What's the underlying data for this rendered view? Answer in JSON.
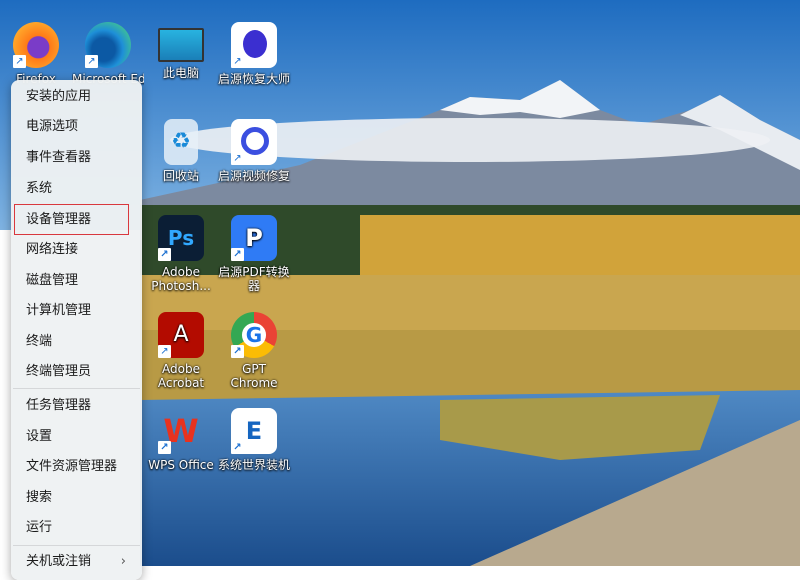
{
  "desktop_icons": [
    {
      "label": "Firefox",
      "color": "#ff7a18"
    },
    {
      "label": "Microsoft Edge",
      "color": "#1e8fd8"
    },
    {
      "label": "此电脑",
      "color": "#2aa6d8"
    },
    {
      "label": "启源恢复大师",
      "color": "#ffffff"
    },
    {
      "label": "回收站",
      "color": "#cfe4f2"
    },
    {
      "label": "启源视频修复",
      "color": "#ffffff"
    },
    {
      "label": "Adobe Photosh...",
      "color": "#0b1e35",
      "glyph": "Ps"
    },
    {
      "label": "启源PDF转换器",
      "color": "#2f7bf5",
      "glyph": "P"
    },
    {
      "label": "Adobe Acrobat",
      "color": "#b30b00",
      "glyph": "A"
    },
    {
      "label": "GPT Chrome",
      "color": "#ffffff",
      "glyph": "G"
    },
    {
      "label": "WPS Office",
      "color": "transparent",
      "glyph": "W"
    },
    {
      "label": "系统世界装机",
      "color": "#ffffff",
      "glyph": "E"
    }
  ],
  "shortcut_arrow": "↗",
  "menu": {
    "items": [
      "安装的应用",
      "电源选项",
      "事件查看器",
      "系统",
      "设备管理器",
      "网络连接",
      "磁盘管理",
      "计算机管理",
      "终端",
      "终端管理员"
    ],
    "items2": [
      "任务管理器",
      "设置",
      "文件资源管理器",
      "搜索",
      "运行",
      "关机或注销"
    ],
    "selected": "设备管理器",
    "submenu_chevron": "›"
  }
}
